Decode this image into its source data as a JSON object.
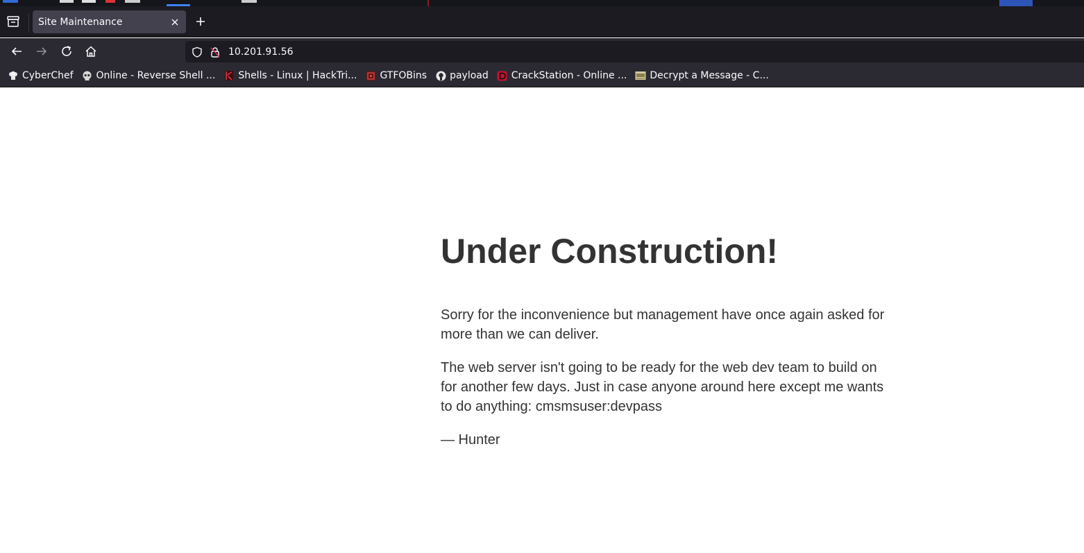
{
  "browser": {
    "tab": {
      "title": "Site Maintenance"
    },
    "url": "10.201.91.56",
    "bookmarks": [
      {
        "label": "CyberChef",
        "icon": "chef-hat-icon"
      },
      {
        "label": "Online - Reverse Shell ...",
        "icon": "skull-icon"
      },
      {
        "label": "Shells - Linux | HackTri...",
        "icon": "hacktricks-icon"
      },
      {
        "label": "GTFOBins",
        "icon": "gtfobins-icon"
      },
      {
        "label": "payload",
        "icon": "github-icon"
      },
      {
        "label": "CrackStation - Online ...",
        "icon": "crackstation-icon"
      },
      {
        "label": "Decrypt a Message - C...",
        "icon": "cipher-icon"
      }
    ]
  },
  "page": {
    "heading": "Under Construction!",
    "paragraphs": [
      "Sorry for the inconvenience but management have once again asked for more than we can deliver.",
      "The web server isn't going to be ready for the web dev team to build on for another few days. Just in case anyone around here except me wants to do anything: cmsmsuser:devpass",
      "— Hunter"
    ]
  },
  "colors": {
    "tabbar_bg": "#1c1b22",
    "toolbar_bg": "#2b2a33",
    "active_tab_bg": "#42414d",
    "text_on_dark": "#fbfbfe",
    "page_text": "#333333"
  }
}
